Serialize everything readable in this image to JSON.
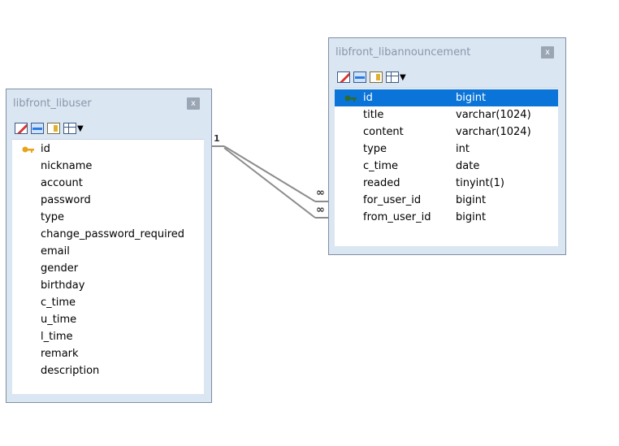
{
  "tables": {
    "libuser": {
      "title": "libfront_libuser",
      "close_label": "x",
      "columns": [
        "id",
        "nickname",
        "account",
        "password",
        "type",
        "change_password_required",
        "email",
        "gender",
        "birthday",
        "c_time",
        "u_time",
        "l_time",
        "remark",
        "description"
      ],
      "primary_key": "id"
    },
    "libannouncement": {
      "title": "libfront_libannouncement",
      "close_label": "x",
      "columns": [
        {
          "name": "id",
          "type": "bigint"
        },
        {
          "name": "title",
          "type": "varchar(1024)"
        },
        {
          "name": "content",
          "type": "varchar(1024)"
        },
        {
          "name": "type",
          "type": "int"
        },
        {
          "name": "c_time",
          "type": "date"
        },
        {
          "name": "readed",
          "type": "tinyint(1)"
        },
        {
          "name": "for_user_id",
          "type": "bigint"
        },
        {
          "name": "from_user_id",
          "type": "bigint"
        }
      ],
      "primary_key": "id",
      "selected_row": "id"
    }
  },
  "relations": {
    "one_label": "1",
    "many_label_a": "∞",
    "many_label_b": "∞"
  },
  "colors": {
    "selection": "#0a74d9",
    "table_frame": "#dbe6f3",
    "key_icon": "#e8a317",
    "connector": "#8c8c8c"
  }
}
